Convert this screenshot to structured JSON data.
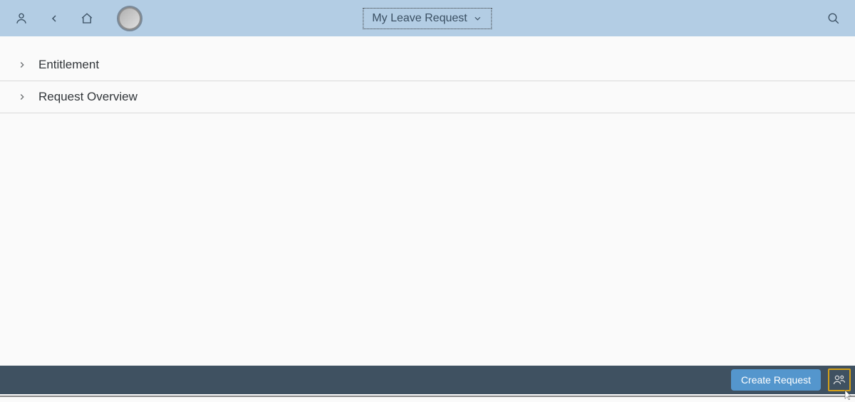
{
  "header": {
    "title": "My Leave Request"
  },
  "sections": [
    {
      "label": "Entitlement"
    },
    {
      "label": "Request Overview"
    }
  ],
  "footer": {
    "create_request_label": "Create Request"
  }
}
